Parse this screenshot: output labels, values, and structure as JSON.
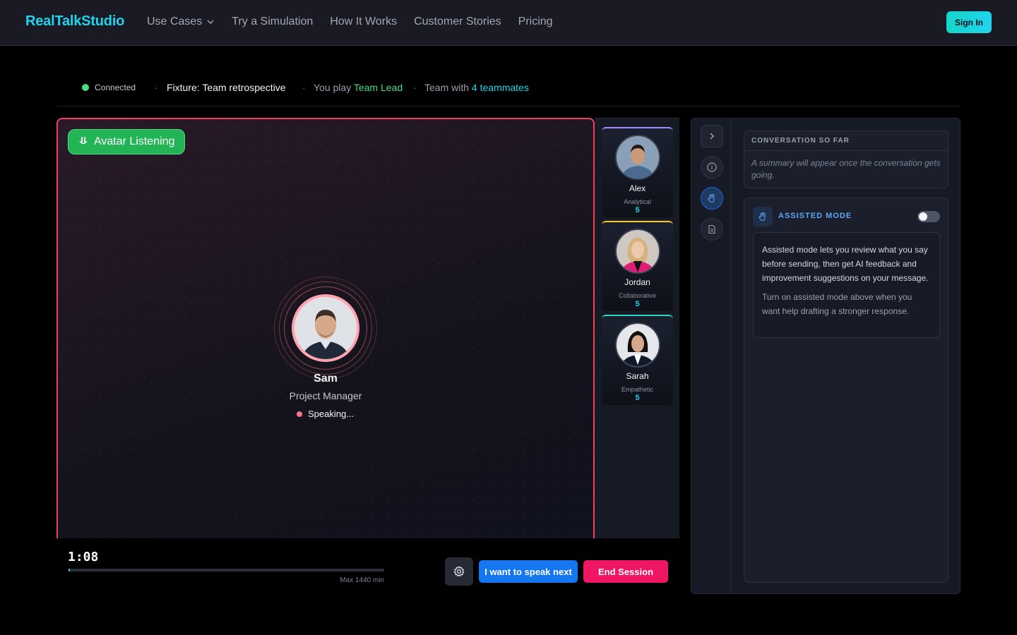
{
  "nav": {
    "brand": "RealTalkStudio",
    "links": [
      "Use Cases",
      "Try a Simulation",
      "How It Works",
      "Customer Stories",
      "Pricing"
    ],
    "signin": "Sign In"
  },
  "status": {
    "connection": "Connected",
    "fixture": "Fixture: Team retrospective",
    "you_play_prefix": "You play",
    "role": "Team Lead",
    "team_prefix": "Team with",
    "teammates": "4 teammates",
    "separator": "·"
  },
  "stage": {
    "badge": "Avatar Listening",
    "speaker_name": "Sam",
    "speaker_role": "Project Manager",
    "speaking_text": "Speaking..."
  },
  "teammates": [
    {
      "name": "Alex",
      "trait": "Analytical",
      "score": "5",
      "accent": "#a78bfa"
    },
    {
      "name": "Jordan",
      "trait": "Collaborative",
      "score": "5",
      "accent": "#facc15"
    },
    {
      "name": "Sarah",
      "trait": "Empathetic",
      "score": "5",
      "accent": "#2dd4bf"
    }
  ],
  "controls": {
    "timer": "1:08",
    "max_label": "Max 1440 min",
    "progress_fraction": 0.0008,
    "speak_button": "I want to speak next",
    "end_button": "End Session"
  },
  "panel": {
    "rail_icons": [
      "chevron-right-icon",
      "info-icon",
      "hand-icon",
      "document-icon"
    ],
    "summary_title": "CONVERSATION SO FAR",
    "summary_body": "A summary will appear once the conversation gets going.",
    "assisted_title": "ASSISTED MODE",
    "assisted_enabled": false,
    "assisted_text_1": "Assisted mode lets you review what you say before sending, then get AI feedback and improvement suggestions on your message.",
    "assisted_text_2": "Turn on assisted mode above when you want help drafting a stronger response."
  },
  "colors": {
    "brand": "#22d3ee",
    "listening": "#22c55e",
    "speaking_border": "#f43f5e",
    "primary": "#1476f0",
    "danger": "#ef1764"
  }
}
